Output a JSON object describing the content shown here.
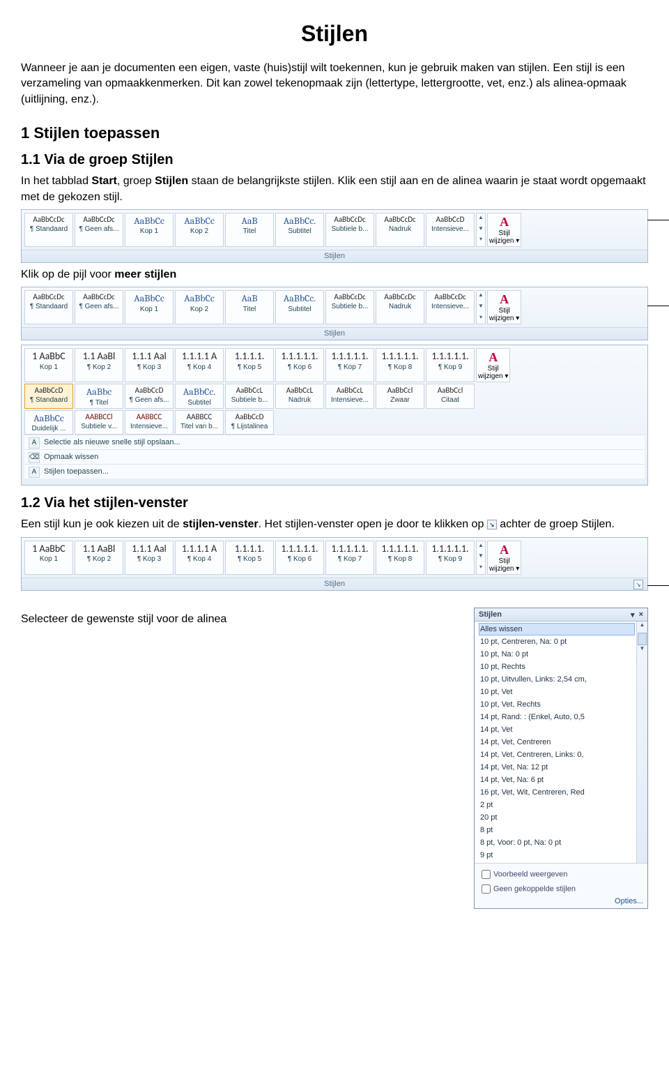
{
  "title": "Stijlen",
  "intro": "Wanneer je aan je documenten een eigen, vaste (huis)stijl wilt toekennen, kun je gebruik maken van stijlen. Een stijl is een verzameling van opmaakkenmerken. Dit kan zowel tekenopmaak zijn (lettertype, lettergrootte, vet, enz.) als alinea-opmaak (uitlijning, enz.).",
  "h2_1": "1    Stijlen toepassen",
  "h3_11": "1.1   Via de groep Stijlen",
  "p11a": "In het tabblad ",
  "p11a_b1": "Start",
  "p11a2": ", groep ",
  "p11a_b2": "Stijlen",
  "p11a3": " staan de belangrijkste stijlen. Klik een stijl aan en de alinea waarin je staat wordt opgemaakt met de gekozen stijl.",
  "p_more": "Klik op de pijl voor ",
  "p_more_b": "meer stijlen",
  "h3_12": "1.2   Via het stijlen-venster",
  "p12a": "Een stijl kun je ook kiezen uit de ",
  "p12a_b": "stijlen-venster",
  "p12a2": ". Het stijlen-venster open je door te klikken op ",
  "p12a3": " achter de groep Stijlen.",
  "p_sel": "Selecteer de gewenste stijl voor de alinea",
  "ribbon1": {
    "cells": [
      {
        "prev": "AaBbCcDc",
        "name": "¶ Standaard",
        "cls": "black sp-small"
      },
      {
        "prev": "AaBbCcDc",
        "name": "¶ Geen afs...",
        "cls": "black sp-small"
      },
      {
        "prev": "AaBbCc",
        "name": "Kop 1",
        "cls": ""
      },
      {
        "prev": "AaBbCc",
        "name": "Kop 2",
        "cls": ""
      },
      {
        "prev": "AaB",
        "name": "Titel",
        "cls": ""
      },
      {
        "prev": "AaBbCc.",
        "name": "Subtitel",
        "cls": ""
      },
      {
        "prev": "AaBbCcDc",
        "name": "Subtiele b...",
        "cls": "black sp-small"
      },
      {
        "prev": "AaBbCcDc",
        "name": "Nadruk",
        "cls": "black sp-small"
      },
      {
        "prev": "AaBbCcD",
        "name": "Intensieve...",
        "cls": "black sp-small"
      }
    ],
    "change": "Stijl wijzigen",
    "group": "Stijlen"
  },
  "ribbon2": {
    "row1": [
      {
        "prev": "AaBbCcDc",
        "name": "¶ Standaard",
        "cls": "black sp-small"
      },
      {
        "prev": "AaBbCcDc",
        "name": "¶ Geen afs...",
        "cls": "black sp-small"
      },
      {
        "prev": "AaBbCc",
        "name": "Kop 1",
        "cls": ""
      },
      {
        "prev": "AaBbCc",
        "name": "Kop 2",
        "cls": ""
      },
      {
        "prev": "AaB",
        "name": "Titel",
        "cls": ""
      },
      {
        "prev": "AaBbCc.",
        "name": "Subtitel",
        "cls": ""
      },
      {
        "prev": "AaBbCcDc",
        "name": "Subtiele b...",
        "cls": "black sp-small"
      },
      {
        "prev": "AaBbCcDc",
        "name": "Nadruk",
        "cls": "black sp-small"
      },
      {
        "prev": "AaBbCcDc",
        "name": "Intensieve...",
        "cls": "black sp-small"
      }
    ],
    "change": "Stijl wijzigen",
    "group": "Stijlen"
  },
  "gallery": {
    "row1": [
      {
        "prev": "1 AaBbC",
        "name": "Kop 1",
        "cls": "black"
      },
      {
        "prev": "1.1 AaBl",
        "name": "¶ Kop 2",
        "cls": "black"
      },
      {
        "prev": "1.1.1 Aal",
        "name": "¶ Kop 3",
        "cls": "black"
      },
      {
        "prev": "1.1.1.1 A",
        "name": "¶ Kop 4",
        "cls": "black"
      },
      {
        "prev": "1.1.1.1.",
        "name": "¶ Kop 5",
        "cls": "black"
      },
      {
        "prev": "1.1.1.1.1.",
        "name": "¶ Kop 6",
        "cls": "black"
      },
      {
        "prev": "1.1.1.1.1.",
        "name": "¶ Kop 7",
        "cls": "black"
      },
      {
        "prev": "1.1.1.1.1.",
        "name": "¶ Kop 8",
        "cls": "black"
      },
      {
        "prev": "1.1.1.1.1.",
        "name": "¶ Kop 9",
        "cls": "black"
      }
    ],
    "row2": [
      {
        "prev": "AaBbCcD",
        "name": "¶ Standaard",
        "cls": "black sp-small",
        "sel": true
      },
      {
        "prev": "AaBbc",
        "name": "¶ Titel",
        "cls": ""
      },
      {
        "prev": "AaBbCcD",
        "name": "¶ Geen afs...",
        "cls": "black sp-small"
      },
      {
        "prev": "AaBbCc.",
        "name": "Subtitel",
        "cls": ""
      },
      {
        "prev": "AaBbCcL",
        "name": "Subtiele b...",
        "cls": "black sp-small"
      },
      {
        "prev": "AaBbCcL",
        "name": "Nadruk",
        "cls": "black sp-small"
      },
      {
        "prev": "AaBbCcL",
        "name": "Intensieve...",
        "cls": "black sp-small"
      },
      {
        "prev": "AaBbCcl",
        "name": "Zwaar",
        "cls": "black sp-small"
      },
      {
        "prev": "AaBbCcl",
        "name": "Citaat",
        "cls": "black sp-small"
      }
    ],
    "row3": [
      {
        "prev": "AaBbCc",
        "name": "Duidelijk ...",
        "cls": ""
      },
      {
        "prev": "AABBCCl",
        "name": "Subtiele v...",
        "cls": "red sp-small"
      },
      {
        "prev": "AABBCC",
        "name": "Intensieve...",
        "cls": "red sp-small"
      },
      {
        "prev": "AABBCC",
        "name": "Titel van b...",
        "cls": "black sp-small"
      },
      {
        "prev": "AaBbCcD",
        "name": "¶ Lijstalinea",
        "cls": "black sp-small"
      }
    ],
    "menu": [
      "Selectie als nieuwe snelle stijl opslaan...",
      "Opmaak wissen",
      "Stijlen toepassen..."
    ],
    "change": "Stijl wijzigen"
  },
  "ribbon3": {
    "cells": [
      {
        "prev": "1 AaBbC",
        "name": "Kop 1",
        "cls": "black"
      },
      {
        "prev": "1.1 AaBl",
        "name": "¶ Kop 2",
        "cls": "black"
      },
      {
        "prev": "1.1.1 Aal",
        "name": "¶ Kop 3",
        "cls": "black"
      },
      {
        "prev": "1.1.1.1 A",
        "name": "¶ Kop 4",
        "cls": "black"
      },
      {
        "prev": "1.1.1.1.",
        "name": "¶ Kop 5",
        "cls": "black"
      },
      {
        "prev": "1.1.1.1.1.",
        "name": "¶ Kop 6",
        "cls": "black"
      },
      {
        "prev": "1.1.1.1.1.",
        "name": "¶ Kop 7",
        "cls": "black"
      },
      {
        "prev": "1.1.1.1.1.",
        "name": "¶ Kop 8",
        "cls": "black"
      },
      {
        "prev": "1.1.1.1.1.",
        "name": "¶ Kop 9",
        "cls": "black"
      }
    ],
    "change": "Stijl wijzigen",
    "group": "Stijlen"
  },
  "pane": {
    "title": "Stijlen",
    "items": [
      "Alles wissen",
      "10 pt, Centreren, Na:  0 pt",
      "10 pt, Na:  0 pt",
      "10 pt, Rechts",
      "10 pt, Uitvullen, Links:  2,54 cm,",
      "10 pt, Vet",
      "10 pt, Vet, Rechts",
      "14 pt, Rand: : (Enkel, Auto,  0,5",
      "14 pt, Vet",
      "14 pt, Vet, Centreren",
      "14 pt, Vet, Centreren, Links:  0,",
      "14 pt, Vet, Na:  12 pt",
      "14 pt, Vet, Na:  6 pt",
      "16 pt, Vet, Wit, Centreren, Red",
      "2 pt",
      "20 pt",
      "8 pt",
      "8 pt, Voor:  0 pt, Na:  0 pt",
      "9 pt"
    ],
    "cb1": "Voorbeeld weergeven",
    "cb2": "Geen gekoppelde stijlen",
    "opts": "Opties..."
  }
}
